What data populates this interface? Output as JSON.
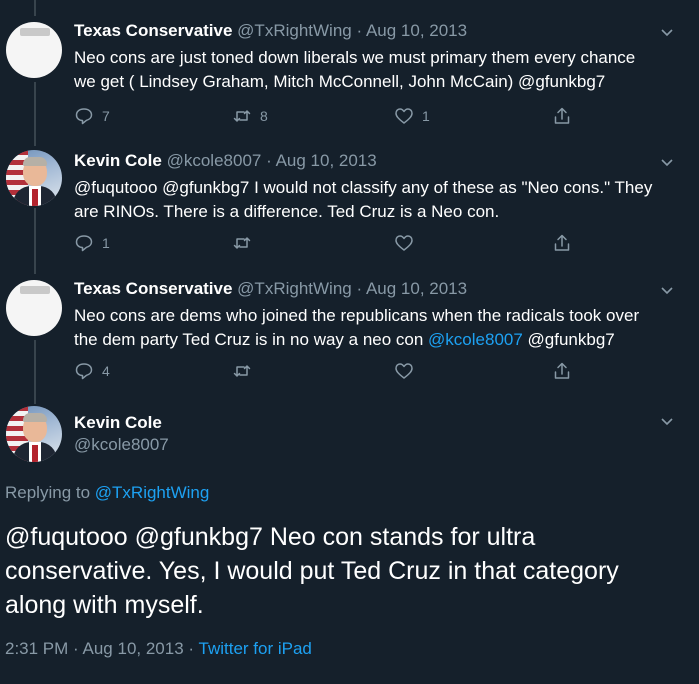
{
  "tweets": [
    {
      "name": "Texas Conservative",
      "handle": "@TxRightWing",
      "separator": "·",
      "date": "Aug 10, 2013",
      "text_line1": "Neo cons are just toned down liberals we must primary them every chance",
      "text_line2": "we get ( Lindsey Graham, Mitch McConnell, John McCain) @gfunkbg7",
      "reply_count": "7",
      "retweet_count": "8",
      "like_count": "1"
    },
    {
      "name": "Kevin Cole",
      "handle": "@kcole8007",
      "separator": "·",
      "date": "Aug 10, 2013",
      "text_line1": "@fuqutooo @gfunkbg7 I would not classify any of these as \"Neo cons.\" They",
      "text_line2": "are RINOs. There is a difference. Ted Cruz is a Neo con.",
      "reply_count": "1",
      "retweet_count": "",
      "like_count": ""
    },
    {
      "name": "Texas Conservative",
      "handle": "@TxRightWing",
      "separator": "·",
      "date": "Aug 10, 2013",
      "text_line1": "Neo cons are dems who joined the republicans when the radicals took over",
      "text_line2_prefix": "the dem party Ted Cruz is in no way a neo con ",
      "text_line2_link": "@kcole8007",
      "text_line2_suffix": " @gfunkbg7",
      "reply_count": "4",
      "retweet_count": "",
      "like_count": ""
    }
  ],
  "focused": {
    "name": "Kevin Cole",
    "handle": "@kcole8007",
    "replying_prefix": "Replying to ",
    "replying_to": "@TxRightWing",
    "text_line1": "@fuqutooo @gfunkbg7 Neo con stands for ultra",
    "text_line2": "conservative.  Yes, I would put Ted Cruz in that category",
    "text_line3": "along with myself.",
    "time": "2:31 PM",
    "separator": "·",
    "date": "Aug 10, 2013",
    "source": "Twitter for iPad"
  },
  "icons": {
    "reply": "reply-icon",
    "retweet": "retweet-icon",
    "like": "like-icon",
    "share": "share-icon",
    "more": "chevron-down-icon"
  },
  "colors": {
    "background": "#15202b",
    "text": "#ffffff",
    "muted": "#8899a6",
    "link": "#1da1f2"
  }
}
